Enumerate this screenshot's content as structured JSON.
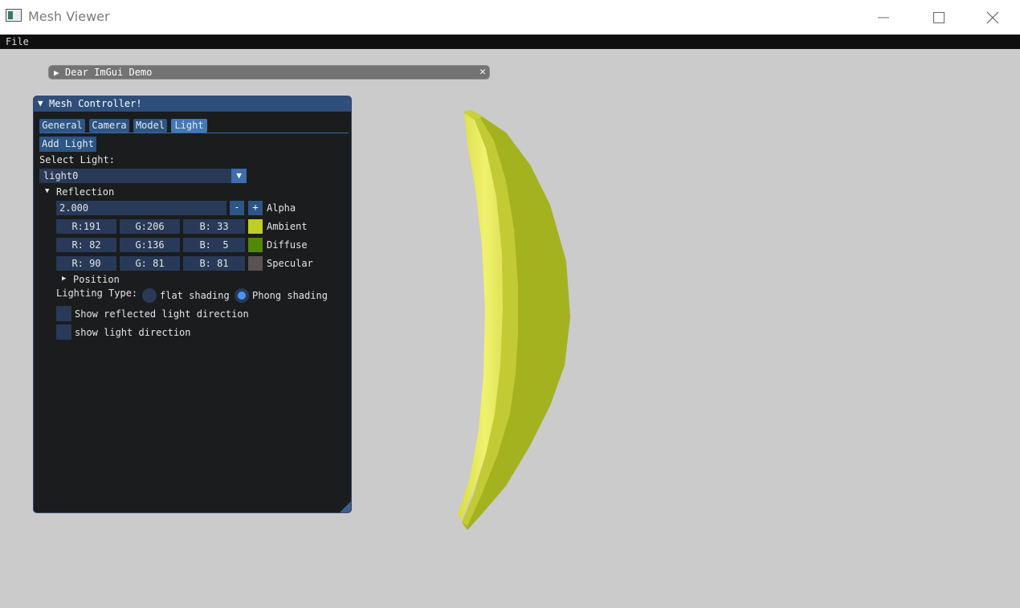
{
  "window": {
    "title": "Mesh Viewer"
  },
  "menu": {
    "items": [
      "File"
    ]
  },
  "demo_window": {
    "title": "Dear ImGui Demo"
  },
  "controller": {
    "title": "Mesh Controller!",
    "tabs": [
      "General",
      "Camera",
      "Model",
      "Light"
    ],
    "active_tab": "Light",
    "add_light_label": "Add Light",
    "select_light_label": "Select Light:",
    "selected_light": "light0",
    "reflection_header": "Reflection",
    "alpha": {
      "value": "2.000",
      "minus": "-",
      "plus": "+",
      "label": "Alpha"
    },
    "ambient": {
      "r": "R:191",
      "g": "G:206",
      "b": "B: 33",
      "label": "Ambient",
      "color": "#bfce21"
    },
    "diffuse": {
      "r": "R: 82",
      "g": "G:136",
      "b": "B:  5",
      "label": "Diffuse",
      "color": "#528805"
    },
    "specular": {
      "r": "R: 90",
      "g": "G: 81",
      "b": "B: 81",
      "label": "Specular",
      "color": "#5a5151"
    },
    "position_header": "Position",
    "lighting_type_label": "Lighting Type:",
    "flat_label": "flat shading",
    "phong_label": "Phong shading",
    "selected_shading": "Phong shading",
    "show_reflected_label": "Show reflected light direction",
    "show_light_dir_label": "show light direction"
  },
  "colors": {
    "viewport_bg": "#cbcbcb",
    "accent": "#2d5586",
    "mesh_light": "#eef06a",
    "mesh_mid": "#c9cf3c",
    "mesh_dark": "#9fae20"
  }
}
